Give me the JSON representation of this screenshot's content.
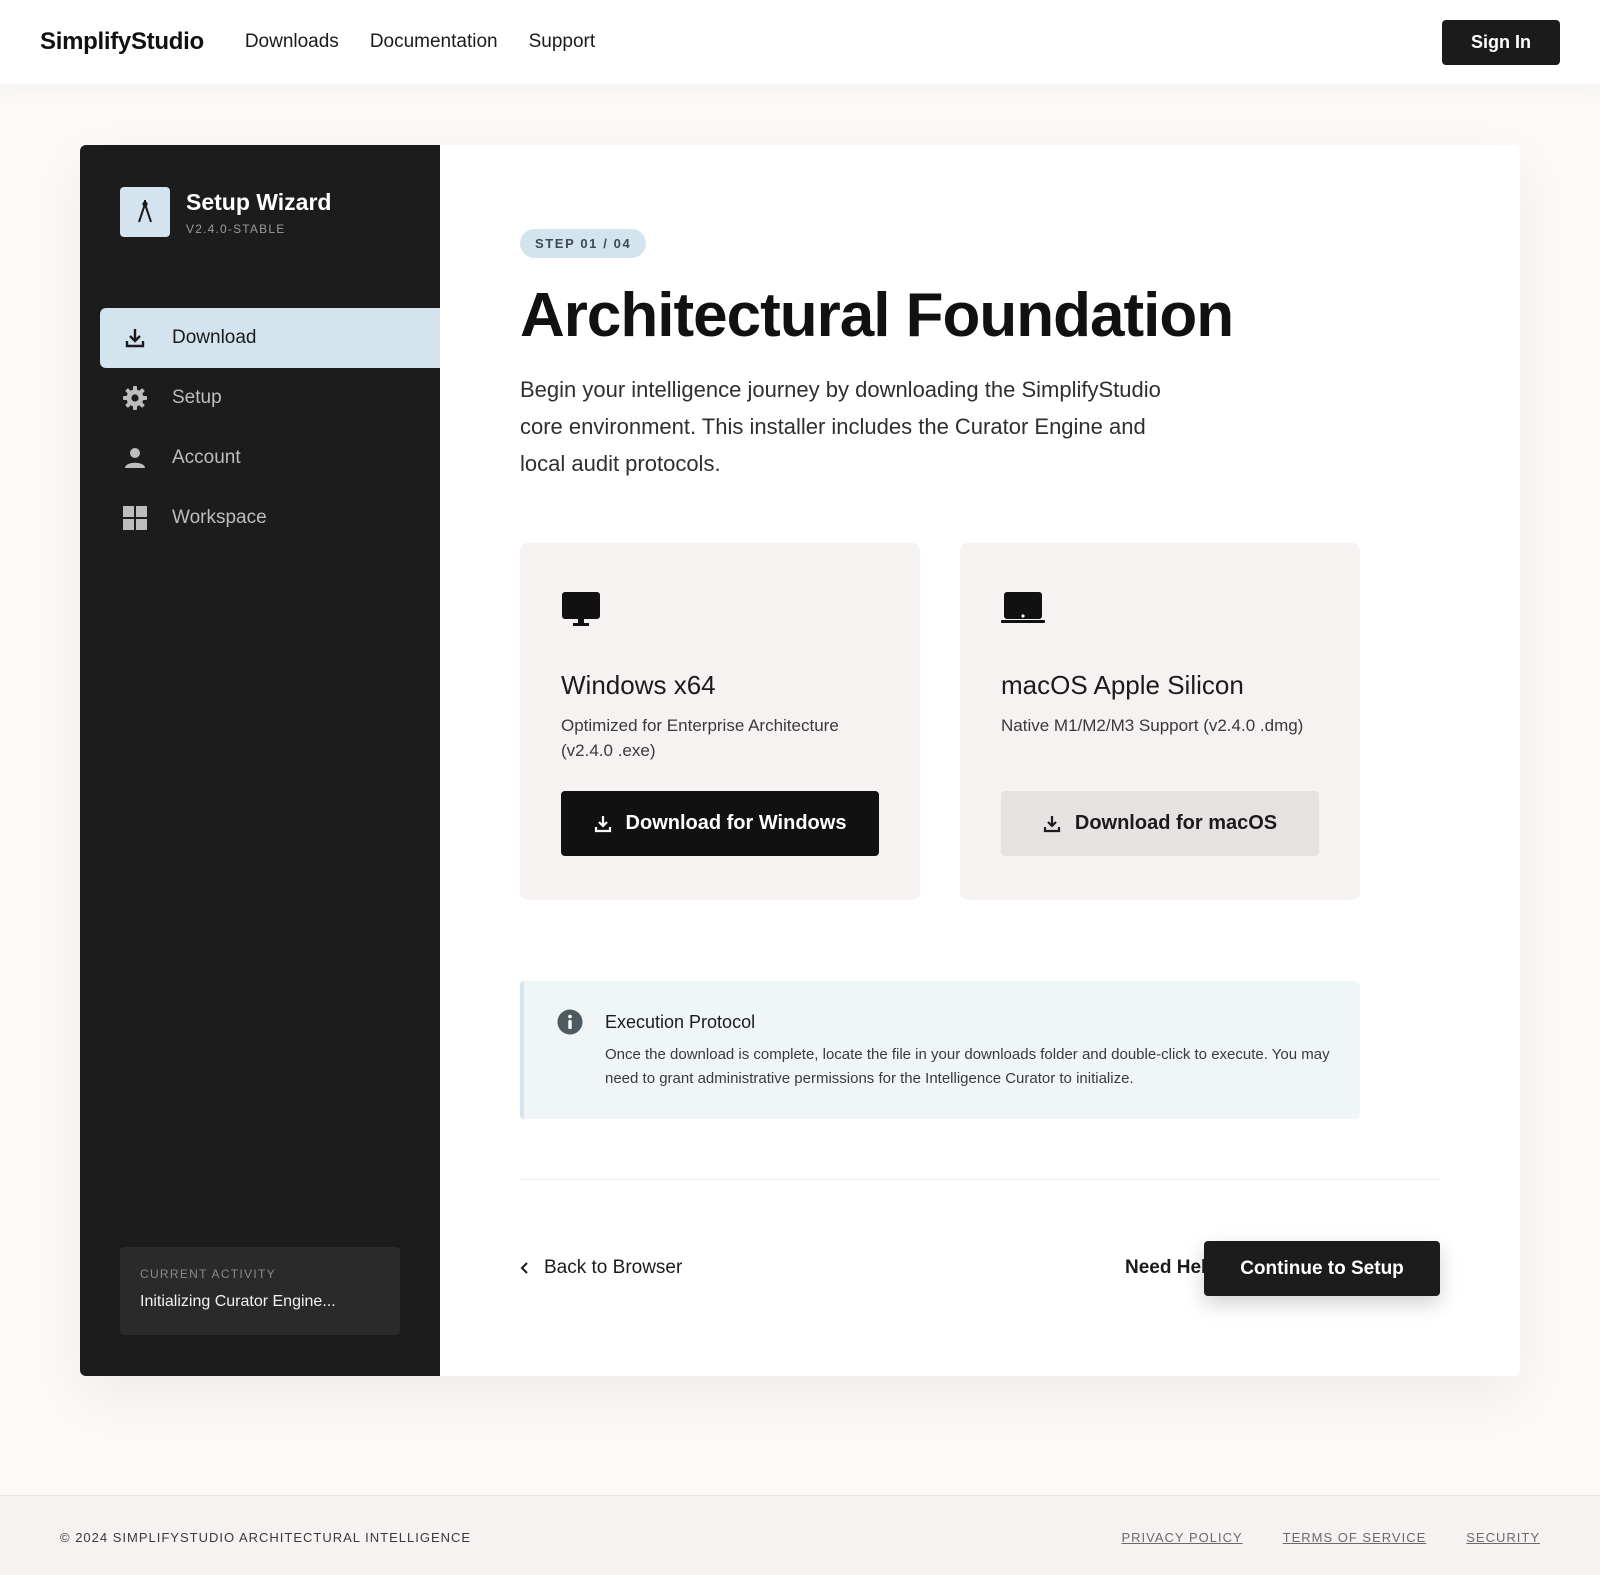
{
  "topnav": {
    "brand": "SimplifyStudio",
    "links": [
      "Downloads",
      "Documentation",
      "Support"
    ],
    "signin_label": "Sign In"
  },
  "sidebar": {
    "title": "Setup Wizard",
    "version": "V2.4.0-STABLE",
    "items": [
      {
        "label": "Download",
        "icon": "download-icon"
      },
      {
        "label": "Setup",
        "icon": "gear-icon"
      },
      {
        "label": "Account",
        "icon": "person-icon"
      },
      {
        "label": "Workspace",
        "icon": "grid-icon"
      }
    ],
    "activity_label": "CURRENT ACTIVITY",
    "activity_text": "Initializing Curator Engine..."
  },
  "main": {
    "step": "STEP 01 / 04",
    "headline": "Architectural Foundation",
    "lede": "Begin your intelligence journey by downloading the SimplifyStudio core environment. This installer includes the Curator Engine and local audit protocols.",
    "platforms": [
      {
        "name": "Windows x64",
        "desc": "Optimized for Enterprise Architecture (v2.4.0 .exe)",
        "button": "Download for Windows",
        "icon": "desktop-monitor-icon"
      },
      {
        "name": "macOS Apple Silicon",
        "desc": "Native M1/M2/M3 Support (v2.4.0 .dmg)",
        "button": "Download for macOS",
        "icon": "laptop-icon"
      }
    ],
    "info_title": "Execution Protocol",
    "info_text": "Once the download is complete, locate the file in your downloads folder and double-click to execute. You may need to grant administrative permissions for the Intelligence Curator to initialize.",
    "back_label": "Back to Browser",
    "help_label": "Need Help?",
    "continue_label": "Continue to Setup"
  },
  "footer": {
    "copyright": "© 2024 SIMPLIFYSTUDIO ARCHITECTURAL INTELLIGENCE",
    "links": [
      "PRIVACY POLICY",
      "TERMS OF SERVICE",
      "SECURITY"
    ]
  },
  "colors": {
    "accent": "#d3e4ee",
    "sidebar_bg": "#1c1c1c",
    "primary_button": "#111111"
  }
}
